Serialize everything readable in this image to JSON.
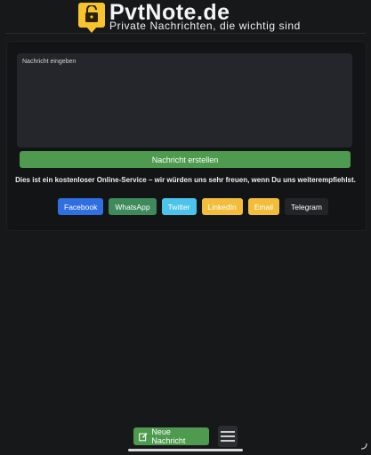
{
  "header": {
    "brand": "PvtNote.de",
    "tagline": "Private Nachrichten, die wichtig sind"
  },
  "editor": {
    "placeholder": "Nachricht eingeben"
  },
  "actions": {
    "create_label": "Nachricht erstellen"
  },
  "info": {
    "text": "Dies ist ein kostenloser Online-Service – wir würden uns sehr freuen, wenn Du uns weiterempfiehlst."
  },
  "share": {
    "items": [
      {
        "label": "Facebook",
        "color": "#2f6fe0"
      },
      {
        "label": "WhatsApp",
        "color": "#3e8a5a"
      },
      {
        "label": "Twitter",
        "color": "#4bc3ea"
      },
      {
        "label": "LinkedIn",
        "color": "#f1bd3a"
      },
      {
        "label": "Email",
        "color": "#f1bd3a"
      },
      {
        "label": "Telegram",
        "color": "#232428"
      }
    ]
  },
  "footer": {
    "new_label": "Neue Nachricht"
  },
  "colors": {
    "accent": "#f7c42e",
    "primary_green": "#4e9a4e",
    "background": "#17181a"
  }
}
